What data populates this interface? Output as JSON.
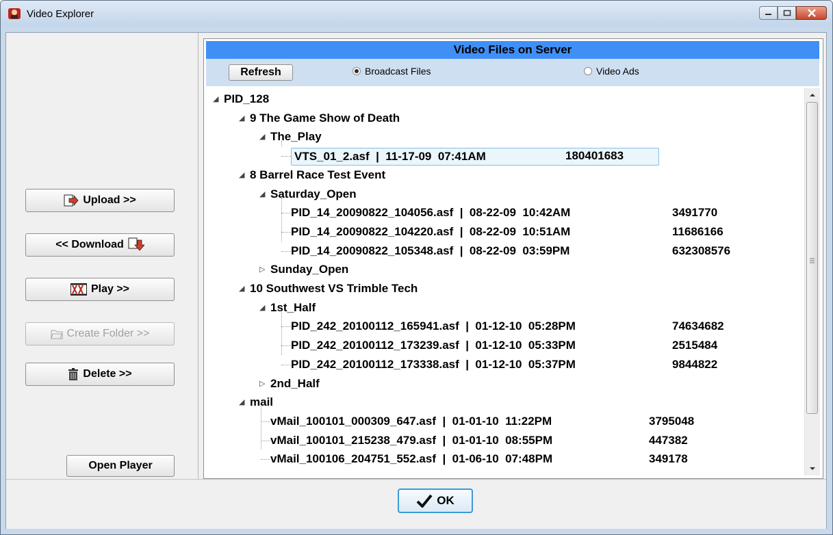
{
  "window": {
    "title": "Video Explorer"
  },
  "left": {
    "upload": "Upload >>",
    "download": "<< Download",
    "play": "Play >>",
    "create_folder": "Create Folder >>",
    "delete": "Delete >>",
    "open_player": "Open Player"
  },
  "panel": {
    "header": "Video Files on Server",
    "refresh": "Refresh",
    "radio_broadcast": "Broadcast Files",
    "radio_ads": "Video Ads",
    "selected_radio": "Broadcast Files"
  },
  "tree": [
    {
      "text": "PID_128",
      "level": 0,
      "expander": "open"
    },
    {
      "text": "9 The Game Show of Death",
      "level": 1,
      "expander": "open"
    },
    {
      "text": "The_Play",
      "level": 2,
      "expander": "open"
    },
    {
      "text": "VTS_01_2.asf  |  11-17-09  07:41AM",
      "size": "180401683",
      "level": 3,
      "selected": true
    },
    {
      "text": "8 Barrel Race Test Event",
      "level": 1,
      "expander": "open"
    },
    {
      "text": "Saturday_Open",
      "level": 2,
      "expander": "open"
    },
    {
      "text": "PID_14_20090822_104056.asf  |  08-22-09  10:42AM",
      "size": "3491770",
      "level": 3
    },
    {
      "text": "PID_14_20090822_104220.asf  |  08-22-09  10:51AM",
      "size": "11686166",
      "level": 3
    },
    {
      "text": "PID_14_20090822_105348.asf  |  08-22-09  03:59PM",
      "size": "632308576",
      "level": 3
    },
    {
      "text": "Sunday_Open",
      "level": 2,
      "expander": "closed"
    },
    {
      "text": "10 Southwest VS Trimble Tech",
      "level": 1,
      "expander": "open"
    },
    {
      "text": "1st_Half",
      "level": 2,
      "expander": "open"
    },
    {
      "text": "PID_242_20100112_165941.asf  |  01-12-10  05:28PM",
      "size": "74634682",
      "level": 3
    },
    {
      "text": "PID_242_20100112_173239.asf  |  01-12-10  05:33PM",
      "size": "2515484",
      "level": 3
    },
    {
      "text": "PID_242_20100112_173338.asf  |  01-12-10  05:37PM",
      "size": "9844822",
      "level": 3
    },
    {
      "text": "2nd_Half",
      "level": 2,
      "expander": "closed"
    },
    {
      "text": "mail",
      "level": 1,
      "expander": "open"
    },
    {
      "text": "vMail_100101_000309_647.asf  |  01-01-10  11:22PM",
      "size": "3795048",
      "level": 2
    },
    {
      "text": "vMail_100101_215238_479.asf  |  01-01-10  08:55PM",
      "size": "447382",
      "level": 2
    },
    {
      "text": "vMail_100106_204751_552.asf  |  01-06-10  07:48PM",
      "size": "349178",
      "level": 2
    }
  ],
  "ok": "OK"
}
